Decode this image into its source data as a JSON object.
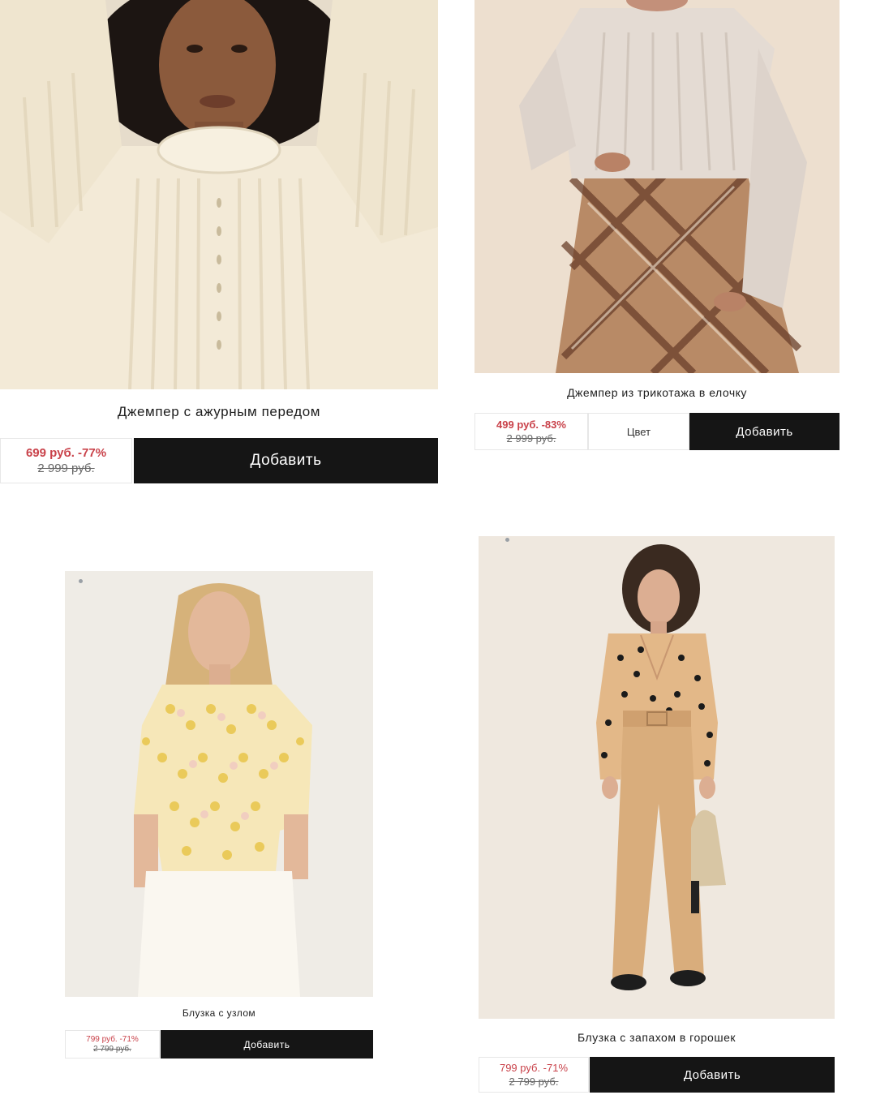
{
  "products": [
    {
      "name": "Джемпер с ажурным передом",
      "price_now": "699 руб. -77%",
      "price_old": "2 999 руб.",
      "add_label": "Добавить",
      "image": "knit-sweater-photo"
    },
    {
      "name": "Джемпер из трикотажа в елочку",
      "price_now": "499 руб. -83%",
      "price_old": "2 999 руб.",
      "color_label": "Цвет",
      "add_label": "Добавить",
      "image": "sweater-plaid-skirt-photo"
    },
    {
      "name": "Блузка с узлом",
      "price_now": "799 руб. -71%",
      "price_old": "2 799 руб.",
      "add_label": "Добавить",
      "image": "printed-blouse-photo"
    },
    {
      "name": "Блузка с запахом в горошек",
      "price_now": "799 руб. -71%",
      "price_old": "2 799 руб.",
      "add_label": "Добавить",
      "image": "polka-dot-blouse-photo"
    }
  ],
  "colors": {
    "accent_price": "#c9424a",
    "button_bg": "#151515"
  }
}
